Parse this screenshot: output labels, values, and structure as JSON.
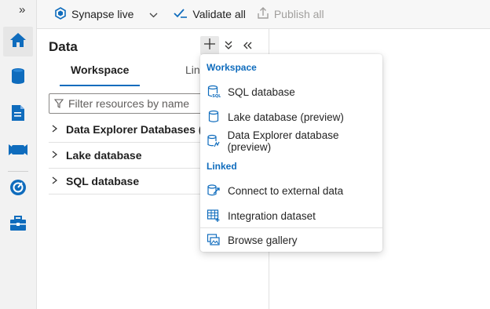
{
  "rail": {
    "collapse_glyph": "»",
    "items": [
      {
        "icon": "home-icon"
      },
      {
        "icon": "data-icon"
      },
      {
        "icon": "develop-icon"
      },
      {
        "icon": "integrate-icon"
      },
      {
        "icon": "monitor-icon"
      },
      {
        "icon": "manage-icon"
      }
    ]
  },
  "toolbar": {
    "workspace_mode": "Synapse live",
    "validate_label": "Validate all",
    "publish_label": "Publish all"
  },
  "panel": {
    "title": "Data",
    "tabs": [
      {
        "label": "Workspace"
      },
      {
        "label": "Lin"
      }
    ],
    "filter_placeholder": "Filter resources by name",
    "tree": [
      {
        "label": "Data Explorer Databases (P"
      },
      {
        "label": "Lake database"
      },
      {
        "label": "SQL database"
      }
    ]
  },
  "menu": {
    "workspace_header": "Workspace",
    "linked_header": "Linked",
    "items": [
      {
        "label": "SQL database",
        "icon": "sql-database-icon"
      },
      {
        "label": "Lake database (preview)",
        "icon": "lake-database-icon"
      },
      {
        "label": "Data Explorer database (preview)",
        "icon": "data-explorer-database-icon"
      },
      {
        "label": "Connect to external data",
        "icon": "external-data-icon"
      },
      {
        "label": "Integration dataset",
        "icon": "integration-dataset-icon"
      },
      {
        "label": "Browse gallery",
        "icon": "gallery-icon"
      }
    ]
  },
  "colors": {
    "accent": "#0f6cbd",
    "rail_background": "#f2f2f2"
  }
}
